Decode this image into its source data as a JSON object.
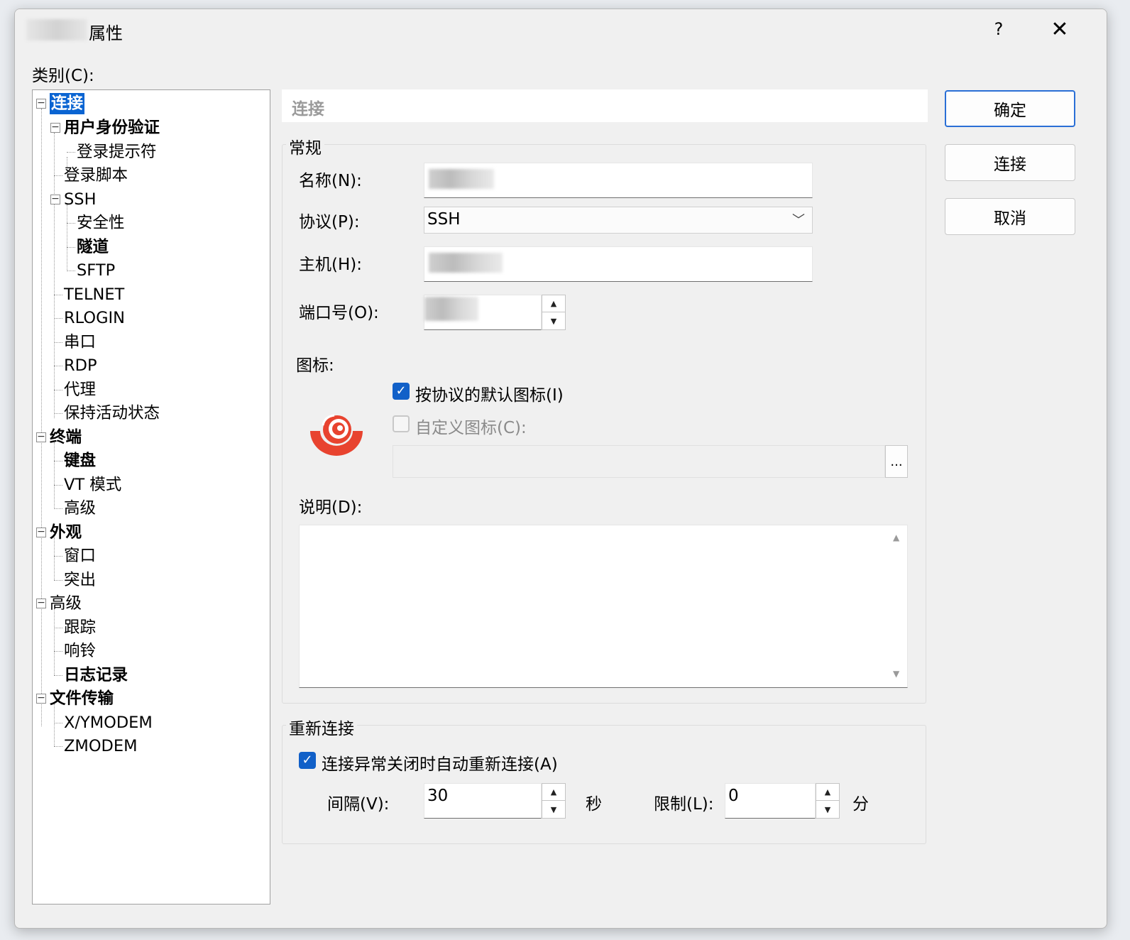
{
  "window": {
    "title": "属性",
    "help": "?",
    "close": "✕"
  },
  "category_label": "类别(C):",
  "tree": [
    {
      "label": "连接",
      "bold": true,
      "selected": true
    },
    {
      "label": "用户身份验证",
      "bold": true
    },
    {
      "label": "登录提示符"
    },
    {
      "label": "登录脚本"
    },
    {
      "label": "SSH"
    },
    {
      "label": "安全性"
    },
    {
      "label": "隧道",
      "bold": true
    },
    {
      "label": "SFTP"
    },
    {
      "label": "TELNET"
    },
    {
      "label": "RLOGIN"
    },
    {
      "label": "串口"
    },
    {
      "label": "RDP"
    },
    {
      "label": "代理"
    },
    {
      "label": "保持活动状态"
    },
    {
      "label": "终端",
      "bold": true
    },
    {
      "label": "键盘",
      "bold": true
    },
    {
      "label": "VT 模式"
    },
    {
      "label": "高级"
    },
    {
      "label": "外观",
      "bold": true
    },
    {
      "label": "窗口"
    },
    {
      "label": "突出"
    },
    {
      "label": "高级"
    },
    {
      "label": "跟踪"
    },
    {
      "label": "响铃"
    },
    {
      "label": "日志记录",
      "bold": true
    },
    {
      "label": "文件传输",
      "bold": true
    },
    {
      "label": "X/YMODEM"
    },
    {
      "label": "ZMODEM"
    }
  ],
  "header": "连接",
  "buttons": {
    "ok": "确定",
    "connect": "连接",
    "cancel": "取消"
  },
  "general": {
    "title": "常规",
    "name_label": "名称(N):",
    "protocol_label": "协议(P):",
    "protocol_value": "SSH",
    "host_label": "主机(H):",
    "port_label": "端口号(O):",
    "icon_label": "图标:",
    "default_icon_label": "按协议的默认图标(I)",
    "default_icon_checked": true,
    "custom_icon_label": "自定义图标(C):",
    "custom_icon_checked": false,
    "browse_label": "...",
    "description_label": "说明(D):"
  },
  "reconnect": {
    "title": "重新连接",
    "auto_label": "连接异常关闭时自动重新连接(A)",
    "auto_checked": true,
    "interval_label": "间隔(V):",
    "interval_value": "30",
    "interval_unit": "秒",
    "limit_label": "限制(L):",
    "limit_value": "0",
    "limit_unit": "分"
  },
  "colors": {
    "selection": "#0a64d2",
    "checkbox": "#1160c8",
    "icon_red": "#e8432f",
    "primary_border": "#2a6fd6"
  }
}
